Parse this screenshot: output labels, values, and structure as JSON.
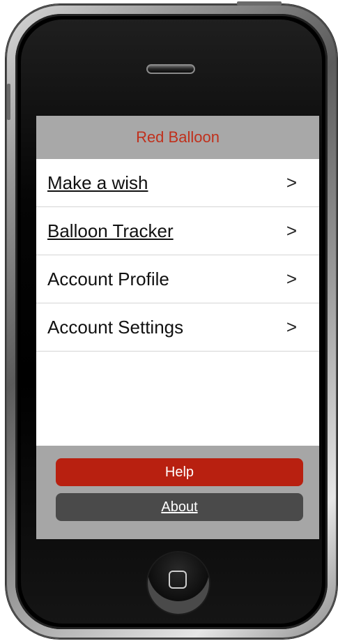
{
  "app": {
    "title": "Red Balloon"
  },
  "menu": {
    "items": [
      {
        "label": "Make a wish",
        "arrow": ">"
      },
      {
        "label": "Balloon Tracker",
        "arrow": ">"
      },
      {
        "label": "Account Profile",
        "arrow": ">"
      },
      {
        "label": "Account Settings",
        "arrow": ">"
      }
    ]
  },
  "footer": {
    "help_label": "Help",
    "about_label": "About"
  },
  "colors": {
    "title": "#c0301c",
    "help_button": "#b82010",
    "about_button": "#4a4a4a",
    "nav_bar": "#a8a8a8"
  },
  "icons": {
    "list_arrow": "chevron-right-icon",
    "home": "home-button-icon"
  }
}
